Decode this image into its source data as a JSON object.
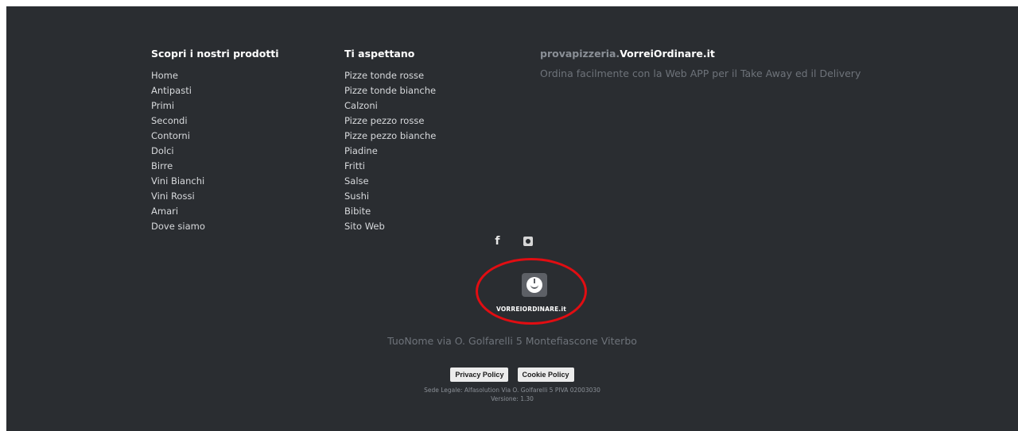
{
  "columns": {
    "products": {
      "heading": "Scopri i nostri prodotti",
      "items": [
        "Home",
        "Antipasti",
        "Primi",
        "Secondi",
        "Contorni",
        "Dolci",
        "Birre",
        "Vini Bianchi",
        "Vini Rossi",
        "Amari",
        "Dove siamo"
      ]
    },
    "waiting": {
      "heading": "Ti aspettano",
      "items": [
        "Pizze tonde rosse",
        "Pizze tonde bianche",
        "Calzoni",
        "Pizze pezzo rosse",
        "Pizze pezzo bianche",
        "Piadine",
        "Fritti",
        "Salse",
        "Sushi",
        "Bibite",
        "Sito Web"
      ]
    },
    "brand": {
      "title_prefix": "provapizzeria.",
      "title_main": "VorreiOrdinare.it",
      "tagline": "Ordina facilmente con la Web APP per il Take Away ed il Delivery"
    }
  },
  "social": {
    "facebook_glyph": "f",
    "icons": [
      "facebook-icon",
      "instagram-icon"
    ]
  },
  "logo": {
    "text": "VORREIORDINARE.it",
    "highlight_color": "#e10d12"
  },
  "address": "TuoNome via O. Golfarelli 5 Montefiascone Viterbo",
  "policies": {
    "privacy": "Privacy Policy",
    "cookie": "Cookie Policy"
  },
  "legal": {
    "line1": "Sede Legale: Alfasolution Via O. Golfarelli 5 PIVA 02003030",
    "line2": "Versione: 1.30"
  }
}
